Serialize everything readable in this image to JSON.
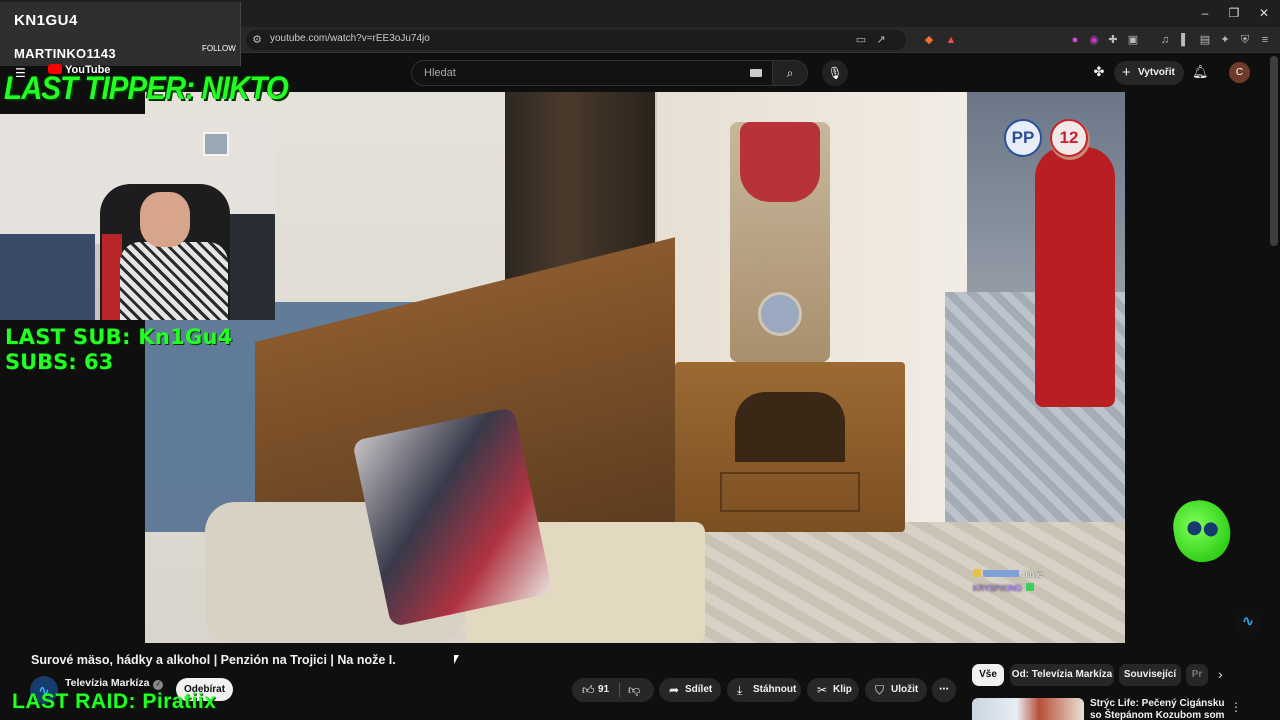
{
  "browser": {
    "url": "youtube.com/watch?v=rEE3oJu74jo",
    "window_controls": {
      "minimize": "–",
      "restore": "❐",
      "close": "✕"
    }
  },
  "masthead": {
    "logo_text": "YouTube",
    "search_placeholder": "Hledat",
    "create_label": "Vytvořit",
    "avatar_letter": "C"
  },
  "overlay": {
    "follower_top": "KN1GU4",
    "follower_bottom": "MARTINKO1143",
    "follow_label": "FOLLOW",
    "last_tipper": "LAST TIPPER: NIKTO",
    "last_sub": "LAST SUB: Kn1Gu4",
    "subs": "SUBS: 63",
    "last_raid": "LAST RAID: Piratiix"
  },
  "video": {
    "rating_badges": [
      "PP",
      "12"
    ],
    "chat": [
      {
        "user": "",
        "text": ": im je"
      },
      {
        "user": "KRYSPIKING",
        "text": ":"
      }
    ]
  },
  "details": {
    "title": "Surové mäso, hádky a alkohol | Penzión na Trojici | Na nože I.",
    "channel_name": "Televízia Markíza",
    "subscribe_label": "Odebírat",
    "like_count": "91",
    "share_label": "Sdílet",
    "download_label": "Stáhnout",
    "clip_label": "Klip",
    "save_label": "Uložit",
    "more_label": "⋯"
  },
  "sidebar": {
    "chips": [
      "Vše",
      "Od: Televízia Markíza",
      "Související",
      "Pr"
    ],
    "recommendation_title": "Strýc Life: Pečený Cigánsku so Štepánom Kozubom som ešte"
  },
  "colors": {
    "overlay_green": "#22ff22",
    "background": "#0f0f0f",
    "youtube_red": "#ff0000"
  }
}
